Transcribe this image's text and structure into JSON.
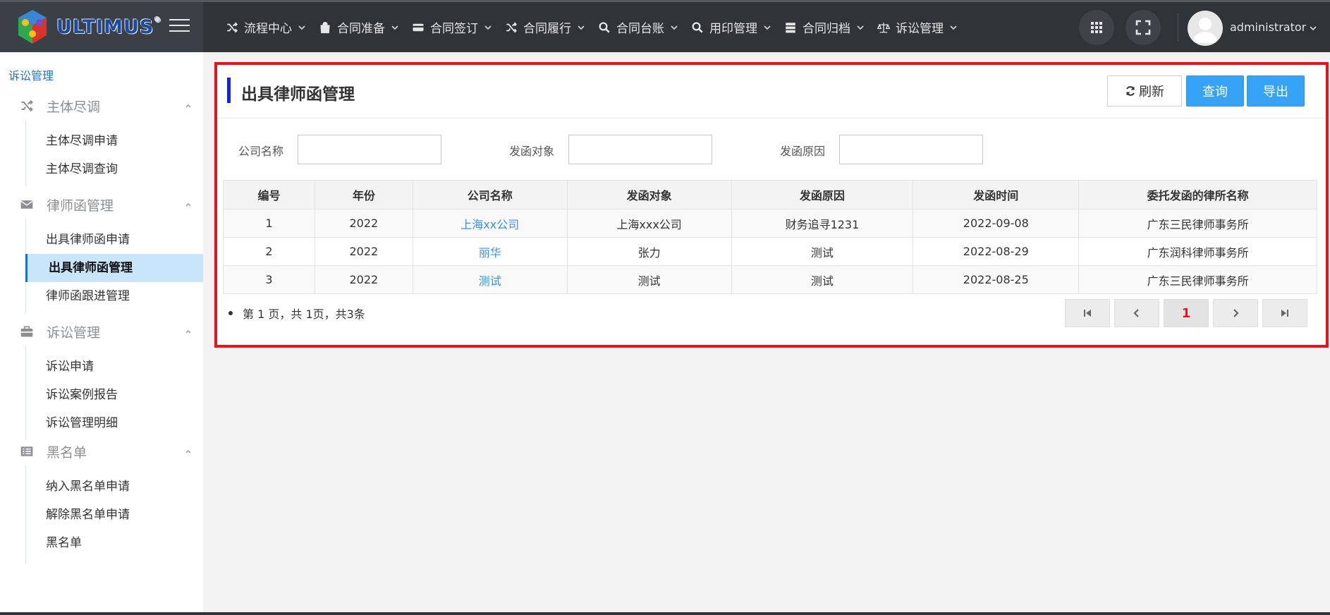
{
  "brand": {
    "logo_text": "ULTIMUS",
    "logo_mark": "®"
  },
  "nav": [
    {
      "label": "流程中心",
      "icon": "shuffle-icon"
    },
    {
      "label": "合同准备",
      "icon": "bag-icon"
    },
    {
      "label": "合同签订",
      "icon": "card-icon"
    },
    {
      "label": "合同履行",
      "icon": "shuffle-icon"
    },
    {
      "label": "合同台账",
      "icon": "search-icon"
    },
    {
      "label": "用印管理",
      "icon": "search-icon"
    },
    {
      "label": "合同归档",
      "icon": "server-icon"
    },
    {
      "label": "诉讼管理",
      "icon": "scale-icon"
    }
  ],
  "user": {
    "name": "administrator"
  },
  "sidebar": {
    "title": "诉讼管理",
    "groups": [
      {
        "label": "主体尽调",
        "icon": "shuffle-icon",
        "items": [
          "主体尽调申请",
          "主体尽调查询"
        ]
      },
      {
        "label": "律师函管理",
        "icon": "envelope-icon",
        "items": [
          "出具律师函申请",
          "出具律师函管理",
          "律师函跟进管理"
        ]
      },
      {
        "label": "诉讼管理",
        "icon": "briefcase-icon",
        "items": [
          "诉讼申请",
          "诉讼案例报告",
          "诉讼管理明细"
        ]
      },
      {
        "label": "黑名单",
        "icon": "list-icon",
        "items": [
          "纳入黑名单申请",
          "解除黑名单申请",
          "黑名单"
        ]
      }
    ],
    "active_item": "出具律师函管理"
  },
  "panel": {
    "title": "出具律师函管理",
    "buttons": {
      "refresh": "刷新",
      "query": "查询",
      "export": "导出"
    },
    "filters": [
      {
        "label": "公司名称",
        "value": ""
      },
      {
        "label": "发函对象",
        "value": ""
      },
      {
        "label": "发函原因",
        "value": ""
      }
    ],
    "table": {
      "columns": [
        "编号",
        "年份",
        "公司名称",
        "发函对象",
        "发函原因",
        "发函时间",
        "委托发函的律所名称"
      ],
      "rows": [
        [
          "1",
          "2022",
          "上海xx公司",
          "上海xxx公司",
          "财务追寻1231",
          "2022-09-08",
          "广东三民律师事务所"
        ],
        [
          "2",
          "2022",
          "丽华",
          "张力",
          "测试",
          "2022-08-29",
          "广东润科律师事务所"
        ],
        [
          "3",
          "2022",
          "测试",
          "测试",
          "测试",
          "2022-08-25",
          "广东三民律师事务所"
        ]
      ]
    },
    "pagination": {
      "info": "第 1 页，共 1页，共3条",
      "current": "1"
    }
  }
}
